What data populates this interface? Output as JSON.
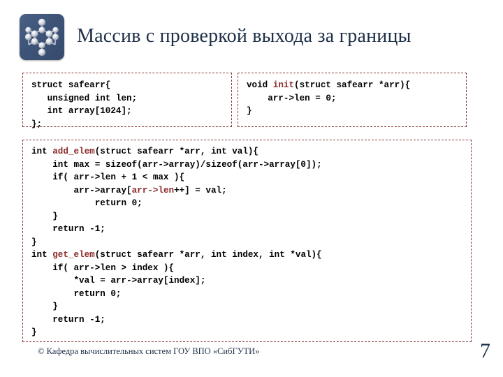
{
  "slide": {
    "title": "Массив с проверкой выхода за границы",
    "logo_icon": "molecule-network-logo",
    "accent_color": "#1e3048",
    "code_keyword_color": "#8c2b2b",
    "border_color": "#8a3a3a"
  },
  "code_blocks": {
    "struct_def": {
      "name": "struct-definition",
      "lines": [
        {
          "segments": [
            {
              "text": "struct safearr{",
              "hl": false
            }
          ]
        },
        {
          "segments": [
            {
              "text": "   unsigned int len;",
              "hl": false
            }
          ]
        },
        {
          "segments": [
            {
              "text": "   int array[1024];",
              "hl": false
            }
          ]
        },
        {
          "segments": [
            {
              "text": "};",
              "hl": false
            }
          ]
        }
      ]
    },
    "init_fn": {
      "name": "init-function",
      "lines": [
        {
          "segments": [
            {
              "text": "void ",
              "hl": false
            },
            {
              "text": "init",
              "hl": true
            },
            {
              "text": "(struct safearr *arr){",
              "hl": false
            }
          ]
        },
        {
          "segments": [
            {
              "text": "    arr->len = 0;",
              "hl": false
            }
          ]
        },
        {
          "segments": [
            {
              "text": "}",
              "hl": false
            }
          ]
        }
      ]
    },
    "main_fns": {
      "name": "add-and-get-functions",
      "lines": [
        {
          "segments": [
            {
              "text": "int ",
              "hl": false
            },
            {
              "text": "add_elem",
              "hl": true
            },
            {
              "text": "(struct safearr *arr, int val){",
              "hl": false
            }
          ]
        },
        {
          "segments": [
            {
              "text": "    int max = sizeof(arr->array)/sizeof(arr->array[0]);",
              "hl": false
            }
          ]
        },
        {
          "segments": [
            {
              "text": "    if( arr->len + 1 < max ){",
              "hl": false
            }
          ]
        },
        {
          "segments": [
            {
              "text": "        arr->array[",
              "hl": false
            },
            {
              "text": "arr->len",
              "hl": true
            },
            {
              "text": "++] = val;",
              "hl": false
            }
          ]
        },
        {
          "segments": [
            {
              "text": "            return 0;",
              "hl": false
            }
          ]
        },
        {
          "segments": [
            {
              "text": "    }",
              "hl": false
            }
          ]
        },
        {
          "segments": [
            {
              "text": "    return -1;",
              "hl": false
            }
          ]
        },
        {
          "segments": [
            {
              "text": "}",
              "hl": false
            }
          ]
        },
        {
          "segments": [
            {
              "text": "int ",
              "hl": false
            },
            {
              "text": "get_elem",
              "hl": true
            },
            {
              "text": "(struct safearr *arr, int index, int *val){",
              "hl": false
            }
          ]
        },
        {
          "segments": [
            {
              "text": "    if( arr->len > index ){",
              "hl": false
            }
          ]
        },
        {
          "segments": [
            {
              "text": "        *val = arr->array[index];",
              "hl": false
            }
          ]
        },
        {
          "segments": [
            {
              "text": "        return 0;",
              "hl": false
            }
          ]
        },
        {
          "segments": [
            {
              "text": "    }",
              "hl": false
            }
          ]
        },
        {
          "segments": [
            {
              "text": "    return -1;",
              "hl": false
            }
          ]
        },
        {
          "segments": [
            {
              "text": "}",
              "hl": false
            }
          ]
        }
      ]
    }
  },
  "footer": {
    "copyright": "© Кафедра вычислительных систем ГОУ ВПО «СибГУТИ»",
    "slide_number": "7"
  }
}
